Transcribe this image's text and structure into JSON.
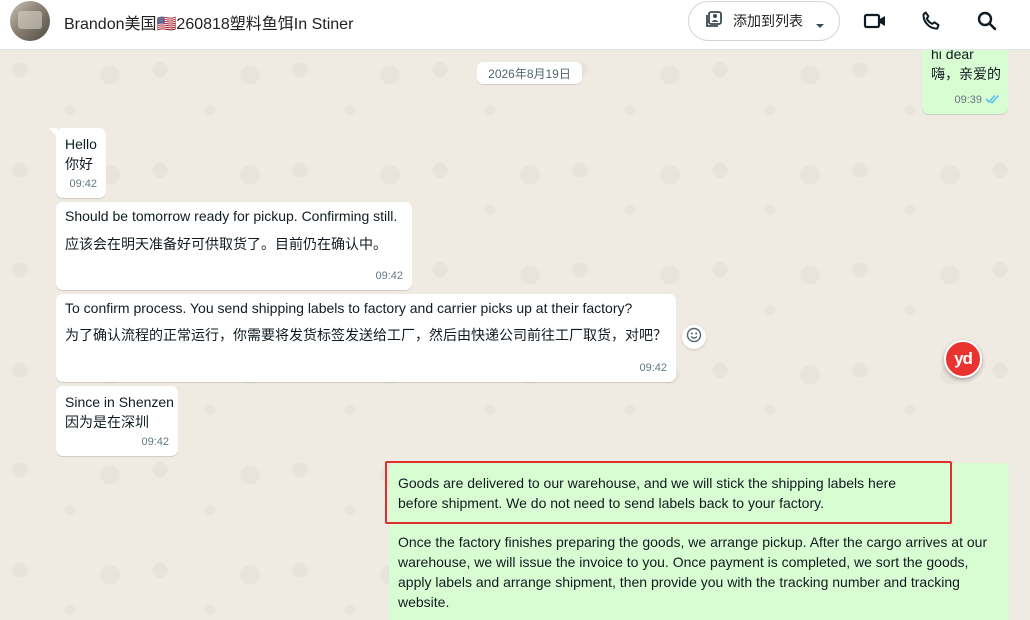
{
  "header": {
    "contact_name": "Brandon美国🇺🇸260818塑料鱼饵In Stiner",
    "add_to_list_label": "添加到列表"
  },
  "chat": {
    "date_chip": "2026年8月19日",
    "messages": [
      {
        "direction": "out",
        "lines": [
          "hi dear",
          "嗨，亲爱的"
        ],
        "time": "09:39",
        "read": true
      },
      {
        "direction": "in",
        "lines": [
          "Hello",
          "你好"
        ],
        "time": "09:42"
      },
      {
        "direction": "in",
        "lines": [
          "Should be tomorrow ready for pickup. Confirming still.",
          "应该会在明天准备好可供取货了。目前仍在确认中。"
        ],
        "time": "09:42"
      },
      {
        "direction": "in",
        "lines": [
          "To confirm process. You send shipping labels to factory and carrier picks up at their factory?",
          "为了确认流程的正常运行，你需要将发货标签发送给工厂，然后由快递公司前往工厂取货，对吧？"
        ],
        "time": "09:42"
      },
      {
        "direction": "in",
        "lines": [
          "Since in Shenzen",
          "因为是在深圳"
        ],
        "time": "09:42"
      },
      {
        "direction": "out",
        "lines": [
          "Goods are delivered to our warehouse, and we will stick the shipping labels here before shipment. We do not need to send labels back to your factory."
        ],
        "highlighted": true
      },
      {
        "direction": "out",
        "lines": [
          "Once the factory finishes preparing the goods, we arrange pickup. After the cargo arrives at our warehouse, we will issue the invoice to you. Once payment is completed, we sort the goods, apply labels and arrange shipment, then provide you with the tracking number and tracking website."
        ]
      }
    ]
  },
  "badge": {
    "text": "yd"
  },
  "colors": {
    "chat_background": "#efeae2",
    "incoming_bubble": "#ffffff",
    "outgoing_bubble": "#d9fdd3",
    "highlight": "#e03131",
    "read_tick": "#53bdeb",
    "badge": "#e8332f"
  },
  "icons": [
    "list-add-icon",
    "chevron-down-icon",
    "video-call-icon",
    "phone-icon",
    "search-icon",
    "emoji-icon",
    "double-check-icon"
  ]
}
